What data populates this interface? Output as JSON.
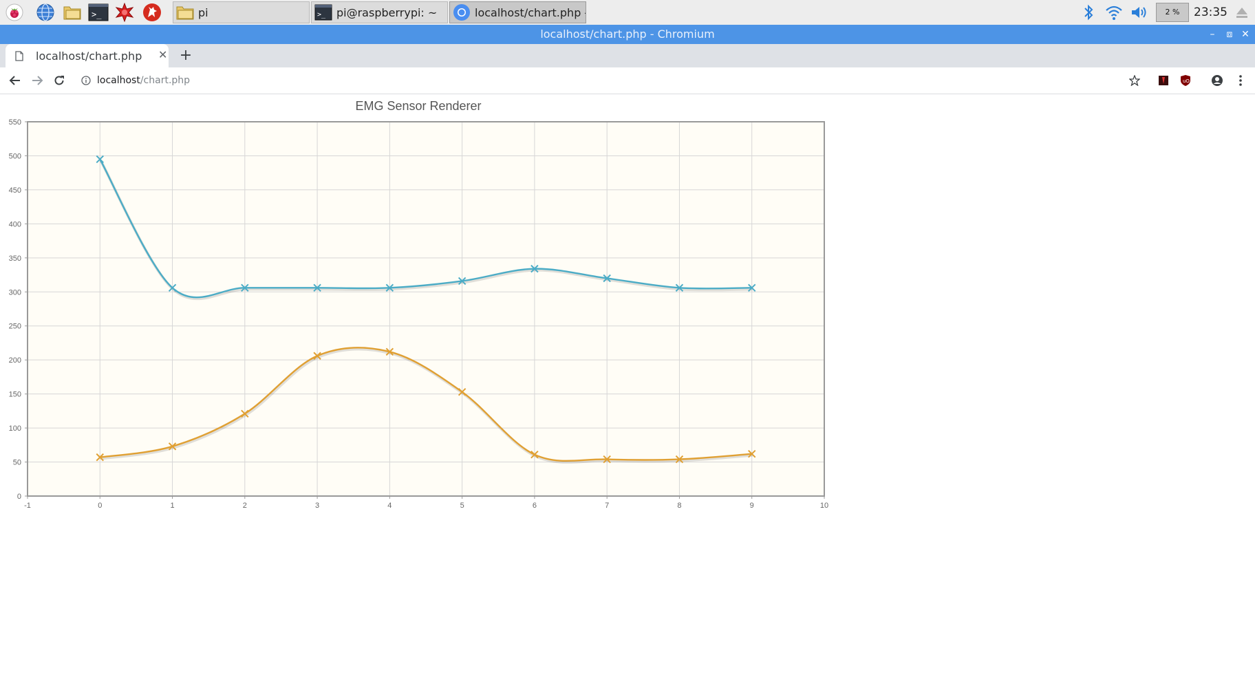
{
  "taskbar": {
    "tasks": [
      {
        "label": "pi"
      },
      {
        "label": "pi@raspberrypi: ~"
      },
      {
        "label": "localhost/chart.php - ..."
      }
    ],
    "cpu_label": "2 %",
    "cpu_usage": 0.02,
    "clock": "23:35"
  },
  "window": {
    "title": "localhost/chart.php - Chromium"
  },
  "browser": {
    "tab_title": "localhost/chart.php",
    "url_host": "localhost",
    "url_path": "/chart.php"
  },
  "colors": {
    "titlebar": "#4d94e6",
    "plot_background": "#fffdf6",
    "series_1": "#4bacc6",
    "series_2": "#e0a033"
  },
  "chart_data": {
    "type": "line",
    "title": "EMG Sensor Renderer",
    "xlabel": "",
    "ylabel": "",
    "xlim": [
      -1,
      10
    ],
    "ylim": [
      0,
      550
    ],
    "x_ticks": [
      -1,
      0,
      1,
      2,
      3,
      4,
      5,
      6,
      7,
      8,
      9,
      10
    ],
    "y_ticks": [
      0,
      50,
      100,
      150,
      200,
      250,
      300,
      350,
      400,
      450,
      500,
      550
    ],
    "grid": true,
    "smooth": true,
    "marker": "x",
    "x": [
      0,
      1,
      2,
      3,
      4,
      5,
      6,
      7,
      8,
      9
    ],
    "series": [
      {
        "values": [
          495,
          306,
          306,
          306,
          306,
          316,
          334,
          320,
          306,
          306
        ],
        "color": "#4bacc6"
      },
      {
        "values": [
          57,
          73,
          121,
          206,
          212,
          153,
          61,
          54,
          54,
          62
        ],
        "color": "#e0a033"
      }
    ]
  }
}
